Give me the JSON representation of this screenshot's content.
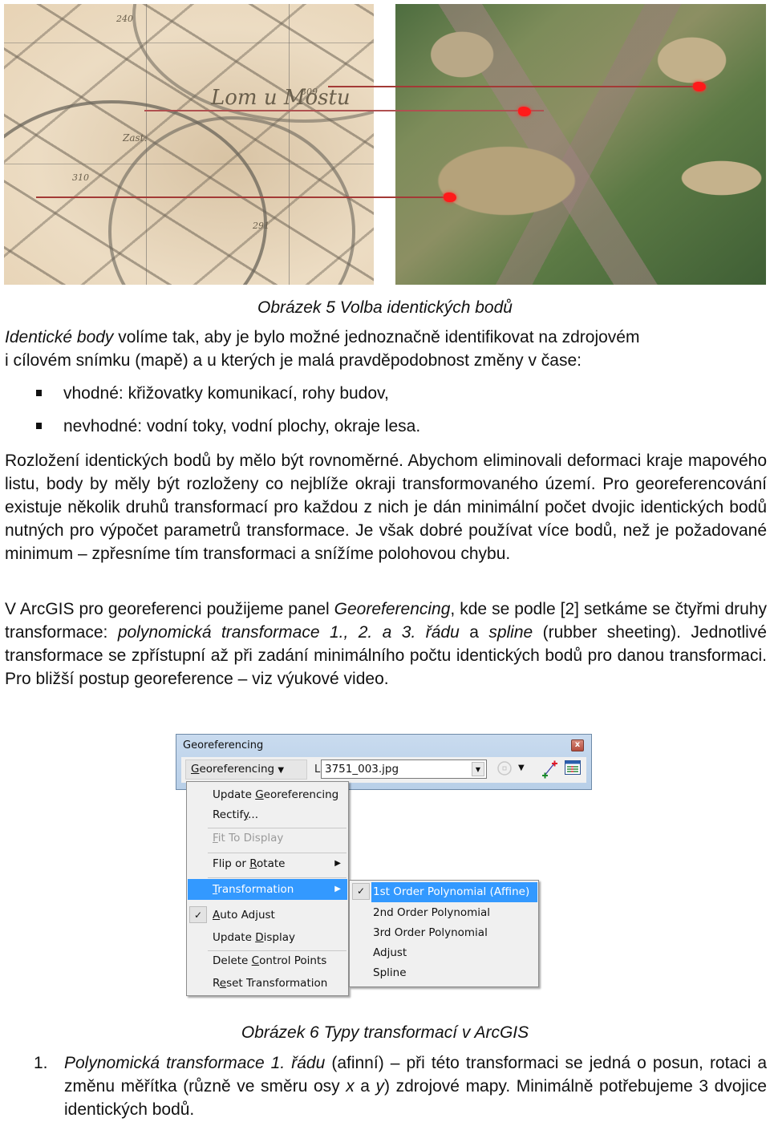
{
  "figure5": {
    "old_map_label": "Lom u Mostu",
    "old_map_minor_labels": [
      "Zast.",
      "310",
      "309",
      "291",
      "240"
    ],
    "caption": "Obrázek 5 Volba identických bodů"
  },
  "intro": {
    "italic_lead": "Identické body",
    "text_line1": " volíme tak, aby je bylo možné jednoznačně identifikovat na zdrojovém",
    "text_line2": "i cílovém snímku (mapě) a u kterých je malá pravděpodobnost změny v čase:"
  },
  "bullets": [
    {
      "text": "vhodné: křižovatky komunikací, rohy budov,"
    },
    {
      "text": "nevhodné: vodní toky, vodní plochy, okraje lesa."
    }
  ],
  "para_distribution": {
    "text": "Rozložení identických bodů by mělo být rovnoměrné. Abychom eliminovali deformaci kraje mapového listu, body by měly být rozloženy co nejblíže okraji transformovaného území. Pro georeferencování existuje několik druhů transformací pro každou z nich je dán minimální počet dvojic identických bodů nutných pro výpočet parametrů transformace. Je však dobré používat více bodů, než je požadované minimum – zpřesníme tím transformaci a snížíme polohovou chybu."
  },
  "para_arcgis": {
    "t1": "V ArcGIS pro georeferenci použijeme panel ",
    "i1": "Georeferencing",
    "t2": ", kde se podle [2] setkáme se čtyřmi druhy transformace: ",
    "i2": "polynomická transformace 1., 2. a 3. řádu",
    "t3": " a ",
    "i3": "spline",
    "t4": " (rubber sheeting). Jednotlivé transformace se zpřístupní až při zadání minimálního počtu identických bodů pro danou transformaci. Pro bližší postup georeference – viz výukové video."
  },
  "arcgis_panel": {
    "title": "Georeferencing",
    "close_glyph": "x",
    "menu_button": {
      "label_accel": "G",
      "label_rest": "eoreferencing",
      "arrow": "▼"
    },
    "layer_label": "Layer:",
    "layer_value": "3751_003.jpg",
    "icons": [
      "rotate-icon",
      "add-control-points-icon",
      "view-link-table-icon"
    ],
    "menu_items": [
      {
        "pre": "Update ",
        "accel": "G",
        "post": "eoreferencing",
        "disabled": false
      },
      {
        "pre": "Rectif",
        "accel": "y",
        "post": "...",
        "disabled": false
      },
      {
        "pre": "",
        "accel": "F",
        "post": "it To Display",
        "disabled": true
      },
      {
        "pre": "Flip or ",
        "accel": "R",
        "post": "otate",
        "submenu": true
      },
      {
        "pre": "",
        "accel": "T",
        "post": "ransformation",
        "submenu": true,
        "highlighted": true
      },
      {
        "pre": "",
        "accel": "A",
        "post": "uto Adjust",
        "checked": true
      },
      {
        "pre": "Update ",
        "accel": "D",
        "post": "isplay"
      },
      {
        "pre": "Delete ",
        "accel": "C",
        "post": "ontrol Points"
      },
      {
        "pre": "R",
        "accel": "e",
        "post": "set Transformation"
      }
    ],
    "submenu_items": [
      {
        "label": "1st Order Polynomial (Affine)",
        "checked": true,
        "highlighted": true
      },
      {
        "label": "2nd Order Polynomial"
      },
      {
        "label": "3rd Order Polynomial"
      },
      {
        "label": "Adjust"
      },
      {
        "label": "Spline"
      }
    ],
    "check_glyph": "✓",
    "submenu_arrow": "▶"
  },
  "figure6": {
    "caption": "Obrázek 6 Typy transformací v ArcGIS"
  },
  "numbered_list": [
    {
      "number": "1.",
      "italic": "Polynomická transformace 1. řádu",
      "t1": " (afinní) – při této transformaci se jedná o posun, rotaci a změnu měřítka (různě ve směru osy ",
      "x": "x",
      "t2": " a ",
      "y": "y",
      "t3": ") zdrojové mapy. Minimálně potřebujeme 3 dvojice identických bodů."
    }
  ],
  "colors": {
    "arrow": "#a33a36",
    "gcp_marker": "#ff1a1a",
    "menu_highlight": "#3399ff"
  }
}
